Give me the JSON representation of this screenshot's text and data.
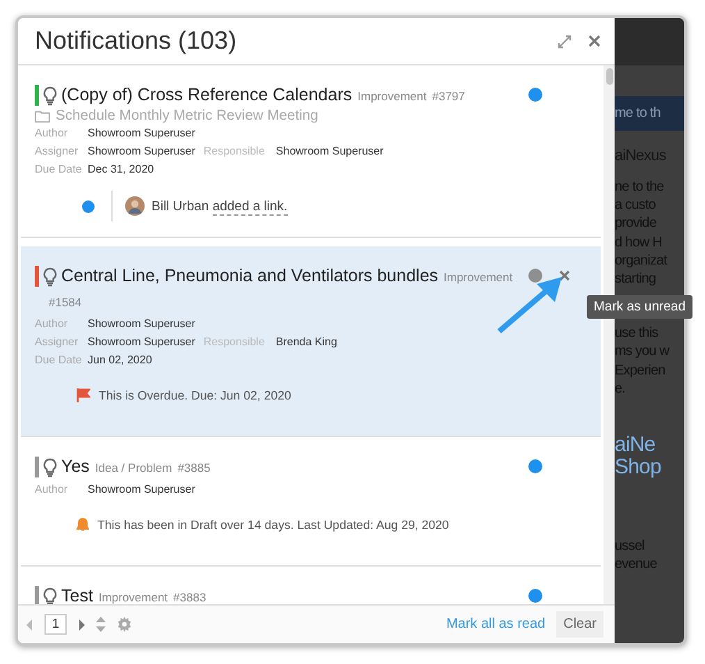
{
  "panel": {
    "title": "Notifications (103)"
  },
  "items": [
    {
      "title": "(Copy of) Cross Reference Calendars",
      "type": "Improvement",
      "number": "#3797",
      "color": "#2fb34a",
      "selected": false,
      "unread": true,
      "project": "Schedule Monthly Metric Review Meeting",
      "field_rows": [
        {
          "pairs": [
            {
              "label": "Author",
              "value": "Showroom Superuser"
            }
          ]
        },
        {
          "pairs": [
            {
              "label": "Assigner",
              "value": "Showroom Superuser"
            },
            {
              "label": "Responsible",
              "value": "Showroom Superuser"
            }
          ]
        },
        {
          "pairs": [
            {
              "label": "Due Date",
              "value": "Dec 31, 2020"
            }
          ]
        }
      ],
      "activity": {
        "unread": true,
        "person": "Bill Urban",
        "action": "added a link."
      }
    },
    {
      "title": "Central Line, Pneumonia and Ventilators bundles",
      "type": "Improvement",
      "number": "#1584",
      "color": "#e5553b",
      "selected": true,
      "unread": false,
      "field_rows": [
        {
          "pairs": [
            {
              "label": "Author",
              "value": "Showroom Superuser"
            }
          ]
        },
        {
          "pairs": [
            {
              "label": "Assigner",
              "value": "Showroom Superuser"
            },
            {
              "label": "Responsible",
              "value": "Brenda King"
            }
          ]
        },
        {
          "pairs": [
            {
              "label": "Due Date",
              "value": "Jun 02, 2020"
            }
          ]
        }
      ],
      "alert": {
        "kind": "overdue",
        "text": "This is Overdue. Due: Jun 02, 2020"
      }
    },
    {
      "title": "Yes",
      "type": "Idea / Problem",
      "number": "#3885",
      "color": "#9a9a9a",
      "selected": false,
      "unread": true,
      "field_rows": [
        {
          "pairs": [
            {
              "label": "Author",
              "value": "Showroom Superuser"
            }
          ]
        }
      ],
      "alert": {
        "kind": "draft",
        "text": "This has been in Draft over 14 days. Last Updated: Aug 29, 2020"
      }
    },
    {
      "title": "Test",
      "type": "Improvement",
      "number": "#3883",
      "color": "#9a9a9a",
      "selected": false,
      "unread": true
    }
  ],
  "tooltip": "Mark as unread",
  "footer": {
    "page": "1",
    "mark_all": "Mark all as read",
    "clear": "Clear"
  },
  "backdrop": {
    "banner": "me to th",
    "blocks": [
      {
        "kind": "heading",
        "lines": [
          "aiNexus"
        ]
      },
      {
        "kind": "text",
        "lines": [
          "ne to the",
          "a custo",
          "provide",
          "d how H",
          "organizat",
          "starting"
        ]
      },
      {
        "kind": "text",
        "lines": [
          "use this",
          "ms you w",
          "Experien",
          "e."
        ]
      },
      {
        "kind": "title",
        "lines": [
          "aiNe",
          "Shop"
        ]
      },
      {
        "kind": "text",
        "lines": [
          "ussel",
          "evenue"
        ]
      }
    ]
  }
}
